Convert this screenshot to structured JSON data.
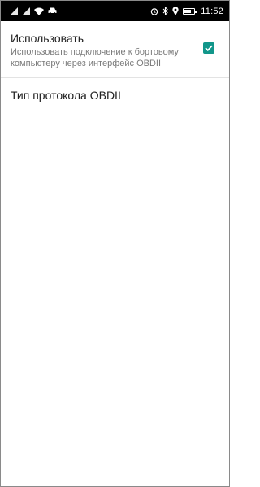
{
  "status_bar": {
    "left_icons": [
      "signal-icon",
      "signal-icon",
      "wifi-icon",
      "car-icon"
    ],
    "right_icons": [
      "alarm-icon",
      "bluetooth-icon",
      "location-icon",
      "battery-icon"
    ],
    "time": "11:52",
    "battery_level": 0.7
  },
  "preferences": {
    "use": {
      "title": "Использовать",
      "summary": "Использовать подключение к бортовому компьютеру через интерфейс OBDII",
      "checked": true
    },
    "protocol": {
      "title": "Тип протокола OBDII"
    }
  },
  "colors": {
    "accent": "#11968a",
    "status_bar": "#000000",
    "divider": "#e3e3e3"
  }
}
